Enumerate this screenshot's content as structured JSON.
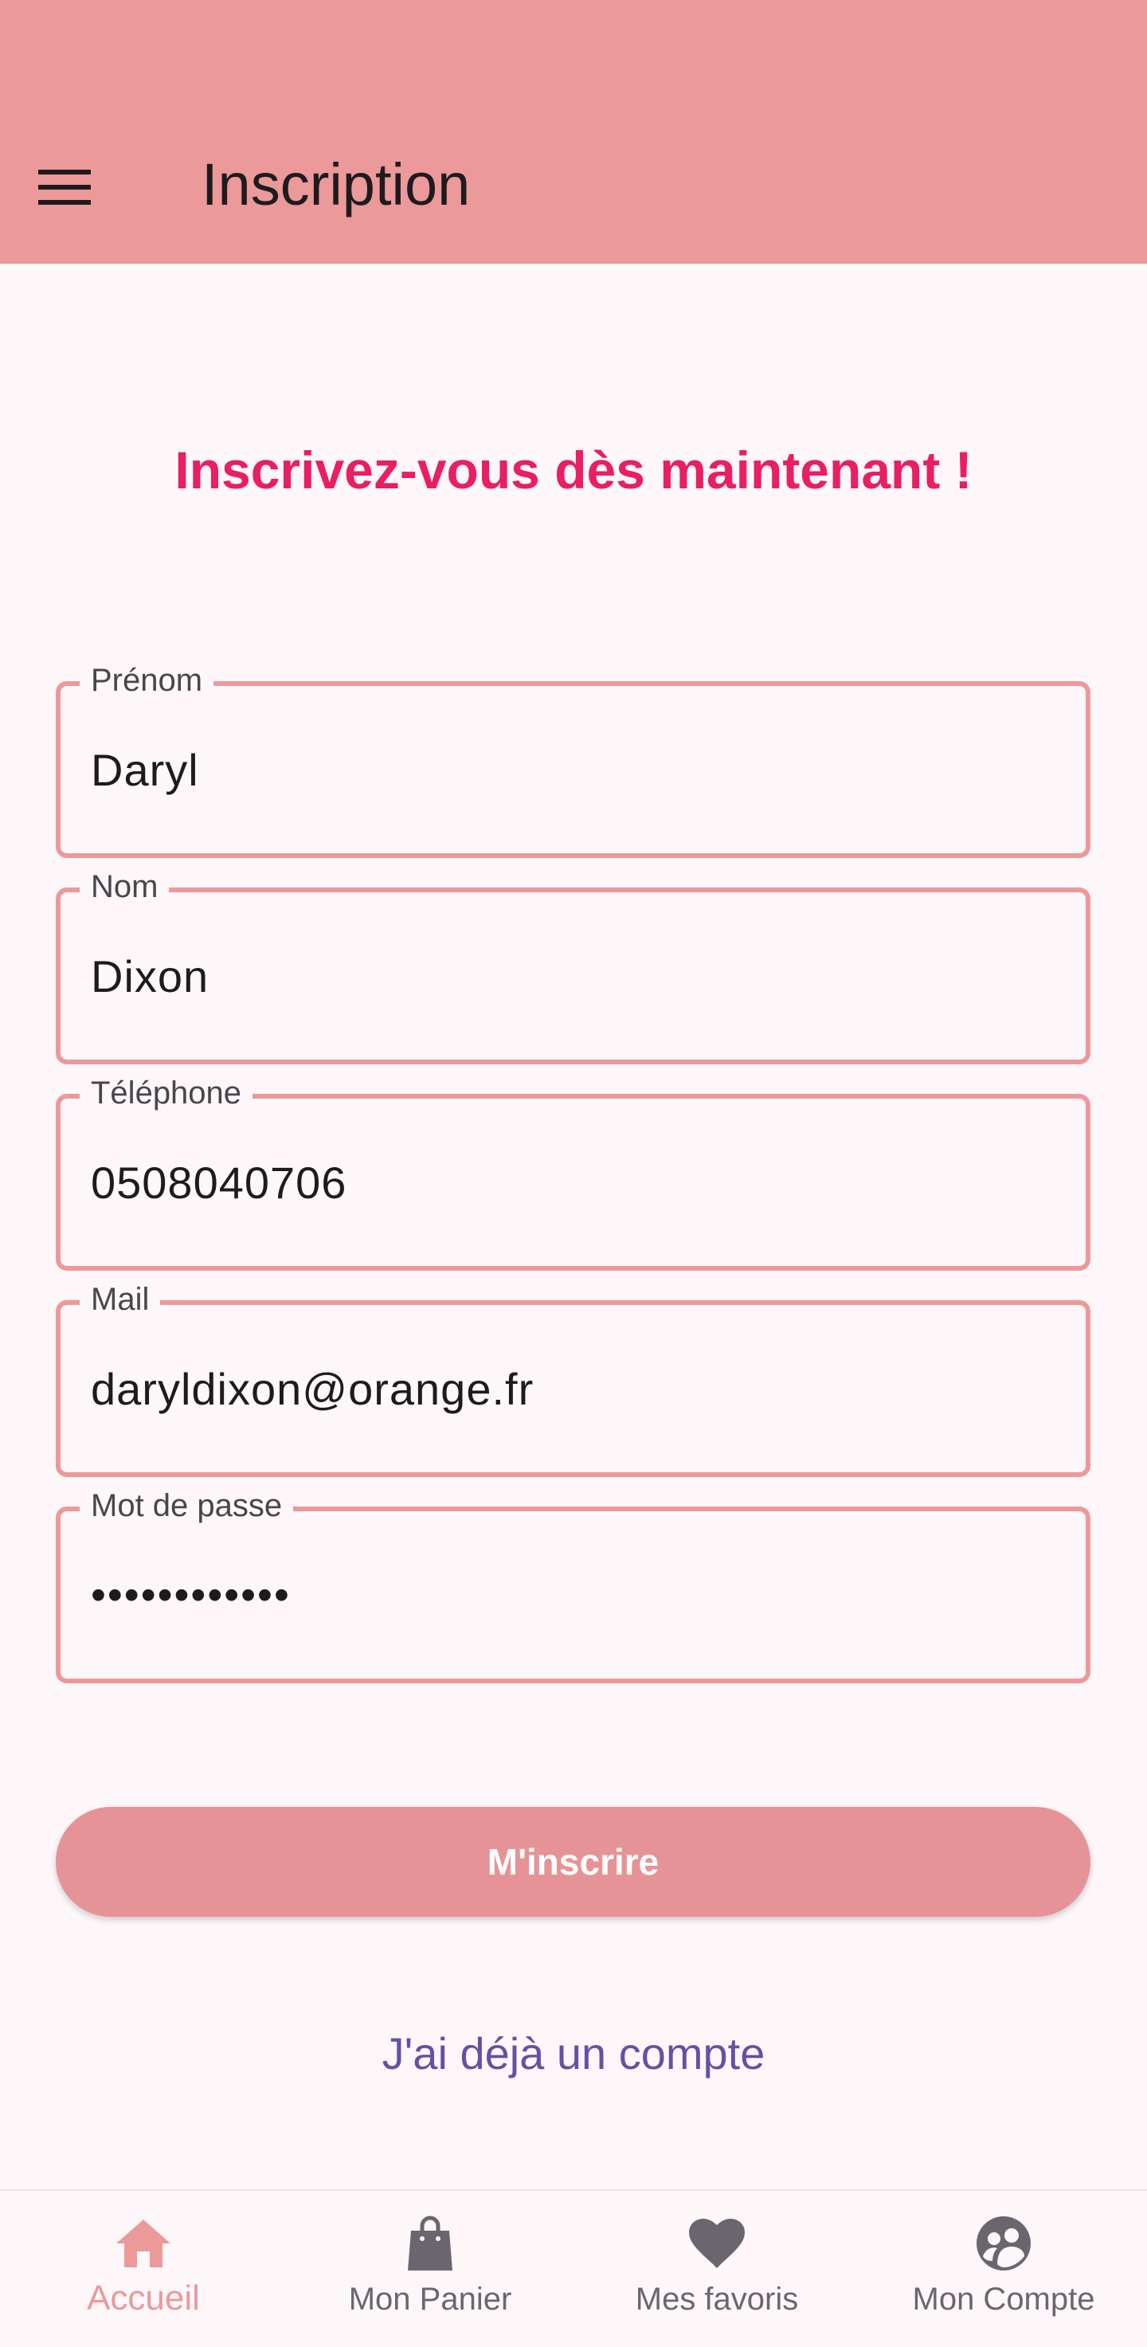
{
  "appbar": {
    "title": "Inscription",
    "menu_icon": "menu-icon"
  },
  "headline": "Inscrivez-vous dès maintenant !",
  "form": {
    "fields": [
      {
        "label": "Prénom",
        "value": "Daryl"
      },
      {
        "label": "Nom",
        "value": "Dixon"
      },
      {
        "label": "Téléphone",
        "value": "0508040706"
      },
      {
        "label": "Mail",
        "value": "daryldixon@orange.fr"
      },
      {
        "label": "Mot de passe",
        "value": "••••••••••••"
      }
    ],
    "submit_label": "M'inscrire",
    "login_link": "J'ai déjà un compte"
  },
  "bottom_nav": {
    "items": [
      {
        "label": "Accueil",
        "icon": "home-icon",
        "active": true
      },
      {
        "label": "Mon Panier",
        "icon": "shopping-bag-icon",
        "active": false
      },
      {
        "label": "Mes favoris",
        "icon": "heart-icon",
        "active": false
      },
      {
        "label": "Mon Compte",
        "icon": "account-group-icon",
        "active": false
      }
    ]
  },
  "colors": {
    "primary": "#ec9999",
    "headline": "#e91e63",
    "link": "#6650a4",
    "background": "#fef7fa"
  }
}
